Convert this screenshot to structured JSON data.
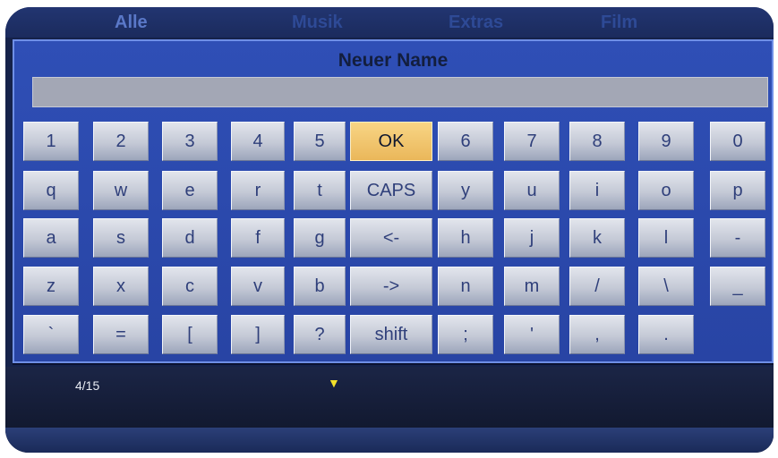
{
  "dialog": {
    "title": "Neuer Name",
    "name_value": ""
  },
  "keyboard": {
    "rows": [
      [
        "1",
        "2",
        "3",
        "4",
        "5",
        "OK",
        "6",
        "7",
        "8",
        "9",
        "0"
      ],
      [
        "q",
        "w",
        "e",
        "r",
        "t",
        "CAPS",
        "y",
        "u",
        "i",
        "o",
        "p"
      ],
      [
        "a",
        "s",
        "d",
        "f",
        "g",
        "<-",
        "h",
        "j",
        "k",
        "l",
        "-"
      ],
      [
        "z",
        "x",
        "c",
        "v",
        "b",
        "->",
        "n",
        "m",
        "/",
        "\\",
        "_"
      ],
      [
        "`",
        "=",
        "[",
        "]",
        "?",
        "shift",
        ";",
        "'",
        ",",
        ".",
        ""
      ]
    ],
    "selected": "OK"
  },
  "footer": {
    "counter": "4/15",
    "scroll_icon": "triangle-down-icon"
  },
  "background_menu": {
    "tabs": [
      "Alle",
      "Musik",
      "Extras",
      "Film"
    ]
  },
  "colors": {
    "dialog": "#2e4eb4",
    "key": "#c8ccd8",
    "selected_key": "#f0c46a",
    "title_text": "#131e3e",
    "scroll_arrow": "#f3e12a"
  }
}
